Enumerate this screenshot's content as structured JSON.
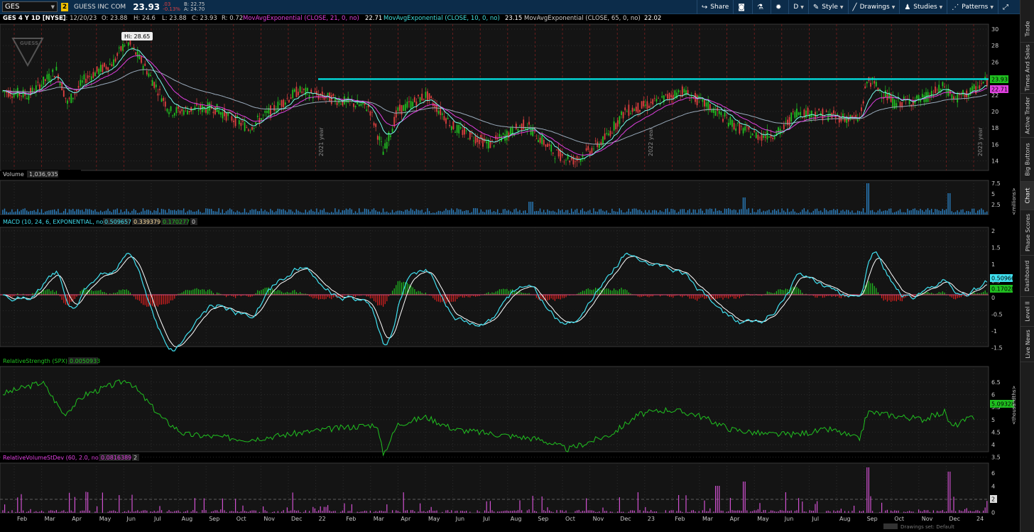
{
  "header": {
    "symbol": "GES",
    "link_badge": "2",
    "company": "GUESS INC COM",
    "last": "23.93",
    "change": ".03",
    "change_pct": "-0.13%",
    "bid": "B: 22.75",
    "ask": "A: 24.70",
    "buttons": [
      "Share",
      "",
      "",
      "",
      "D",
      "Style",
      "Drawings",
      "Studies",
      "Patterns"
    ]
  },
  "price_panel": {
    "title": "GES 4 Y 1D [NYSE]",
    "ohlc": [
      "D: 12/20/23",
      "O: 23.88",
      "H: 24.6",
      "L: 23.88",
      "C: 23.93",
      "R: 0.72"
    ],
    "studies": [
      {
        "label": "MovAvgExponential (CLOSE, 21, 0, no)",
        "value": "22.71",
        "color": "#e040e0"
      },
      {
        "label": "MovAvgExponential (CLOSE, 10, 0, no)",
        "value": "23.15",
        "color": "#40e0e0"
      },
      {
        "label": "MovAvgExponential (CLOSE, 65, 0, no)",
        "value": "22.02",
        "color": "#cfcfcf"
      }
    ],
    "hi_label": "Hi: 28.65",
    "last_tag": "23.93",
    "ema_tag": "22.71",
    "axis_ticks": [
      "30",
      "28",
      "26",
      "24",
      "22",
      "20",
      "18",
      "16",
      "14"
    ],
    "axis_ticks_nums": [
      30,
      28,
      26,
      24,
      22,
      20,
      18,
      16,
      14
    ],
    "resistance": 23.93,
    "accent": "#00e5e5"
  },
  "volume_panel": {
    "label": "Volume",
    "value": "1,036,935",
    "axis_ticks": [
      "7.5",
      "5",
      "2.5"
    ],
    "unit": "<millions>"
  },
  "macd_panel": {
    "label": "MACD (10, 24, 6, EXPONENTIAL, no)",
    "values": [
      "0.509657",
      "0.339379",
      "0.170277",
      "0"
    ],
    "axis_ticks": [
      "2",
      "1.5",
      "1",
      "0.5",
      "0",
      "-0.5",
      "-1",
      "-1.5"
    ],
    "tags": [
      "0.50966",
      "0.17028"
    ]
  },
  "rs_panel": {
    "label": "RelativeStrength (SPX)",
    "value": "0.0050933",
    "axis_ticks": [
      "6.5",
      "6",
      "5.5",
      "5",
      "4.5",
      "4",
      "3.5"
    ],
    "tag": "5.09328",
    "unit": "<thousandths>"
  },
  "rv_panel": {
    "label": "RelativeVolumeStDev (60, 2.0, no)",
    "values": [
      "0.0816389",
      "2"
    ],
    "axis_ticks": [
      "6",
      "4",
      "2",
      "0"
    ],
    "tag": "2"
  },
  "x_axis": {
    "labels": [
      "Feb",
      "Mar",
      "Apr",
      "May",
      "Jun",
      "Jul",
      "Aug",
      "Sep",
      "Oct",
      "Nov",
      "Dec",
      "22",
      "Feb",
      "Mar",
      "Apr",
      "May",
      "Jun",
      "Jul",
      "Aug",
      "Sep",
      "Oct",
      "Nov",
      "Dec",
      "23",
      "Feb",
      "Mar",
      "Apr",
      "May",
      "Jun",
      "Jul",
      "Aug",
      "Sep",
      "Oct",
      "Nov",
      "Dec",
      "24"
    ]
  },
  "year_markers": [
    "2021 year",
    "2022 year",
    "2023 year"
  ],
  "watermark": "Drawings set: Default",
  "sidebar_tabs": [
    "Trade",
    "Times And Sales",
    "Active Trader",
    "Big Buttons",
    "Chart",
    "Phase Scores",
    "Dashboard",
    "Level II",
    "Live News"
  ]
}
